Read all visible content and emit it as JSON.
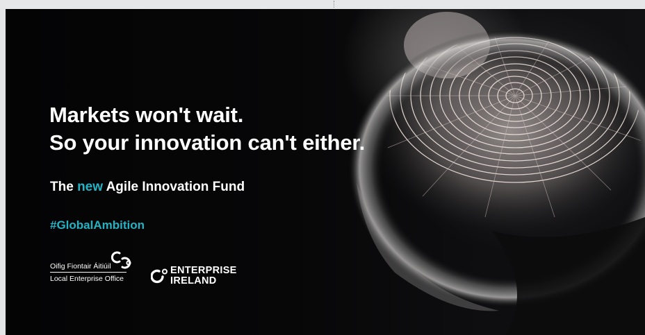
{
  "banner": {
    "headline_line1": "Markets won't wait.",
    "headline_line2": "So your innovation can't either.",
    "subline_prefix": "The ",
    "subline_accent": "new",
    "subline_suffix": " Agile Innovation Fund",
    "hashtag": "#GlobalAmbition",
    "accent_color": "#22b3c4"
  },
  "logos": {
    "local_enterprise_office": {
      "line1": "Oifig Fiontair Áitiúil",
      "line2": "Local Enterprise Office",
      "icon": "leo-linked-rings-icon"
    },
    "enterprise_ireland": {
      "line1": "ENTERPRISE",
      "line2": "IRELAND",
      "icon": "enterprise-ireland-icon"
    }
  }
}
